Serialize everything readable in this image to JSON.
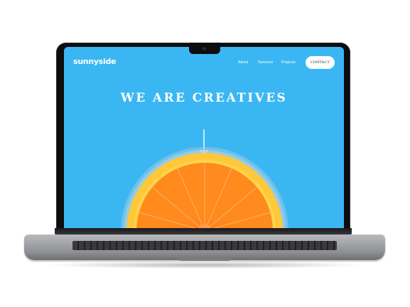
{
  "site": {
    "logo": "sunnyside",
    "nav": {
      "about": "About",
      "services": "Services",
      "projects": "Projects",
      "contact": "CONTACT"
    },
    "hero": {
      "title": "WE ARE CREATIVES"
    }
  },
  "colors": {
    "sky": "#3ab7f3",
    "orange": "#ff6a1a",
    "rind": "#ffb11e",
    "bezel": "#0d0d0f"
  },
  "icons": {
    "scroll": "arrow-down-icon",
    "hero_image": "orange-slice"
  }
}
